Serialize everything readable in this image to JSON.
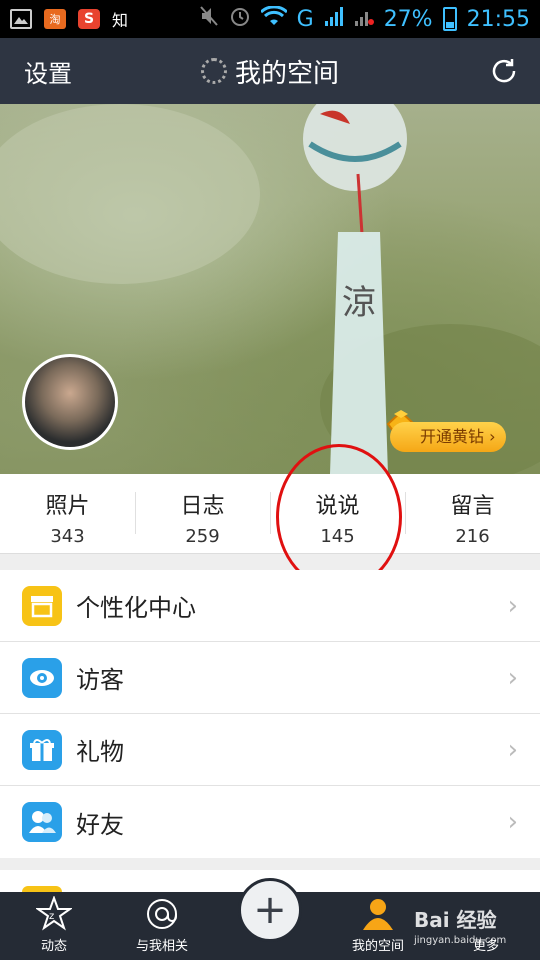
{
  "status_bar": {
    "left_icons": [
      "image-icon",
      "taobao-icon",
      "sogou-icon"
    ],
    "taobao_text": "淘",
    "sogou_text": "S",
    "zhi_text": "知",
    "network": "G",
    "battery": "27%",
    "time": "21:55"
  },
  "header": {
    "settings_label": "设置",
    "title": "我的空间"
  },
  "banner": {
    "vip_button": "开通黄钻"
  },
  "stats": [
    {
      "label": "照片",
      "value": "343"
    },
    {
      "label": "日志",
      "value": "259"
    },
    {
      "label": "说说",
      "value": "145"
    },
    {
      "label": "留言",
      "value": "216"
    }
  ],
  "menu": {
    "items": [
      {
        "label": "个性化中心",
        "icon": "store-icon",
        "color": "#f7c316"
      },
      {
        "label": "访客",
        "icon": "eye-icon",
        "color": "#2aa0e8"
      },
      {
        "label": "礼物",
        "icon": "gift-icon",
        "color": "#2aa0e8"
      },
      {
        "label": "好友",
        "icon": "friends-icon",
        "color": "#2aa0e8"
      }
    ],
    "arrow": "›"
  },
  "bottom_nav": {
    "items": [
      {
        "label": "动态",
        "icon": "star-icon"
      },
      {
        "label": "与我相关",
        "icon": "at-icon"
      },
      {
        "label": "",
        "icon": "plus-icon"
      },
      {
        "label": "我的空间",
        "icon": "person-icon"
      },
      {
        "label": "更多",
        "icon": "more-icon"
      }
    ],
    "plus": "+"
  },
  "watermark": {
    "text": "Bai 经验",
    "sub": "jingyan.baidu.com"
  },
  "colors": {
    "header_bg": "#2e3542",
    "nav_bg": "#252b35",
    "status_accent": "#3fc0ff",
    "annotation_red": "#e01010"
  }
}
